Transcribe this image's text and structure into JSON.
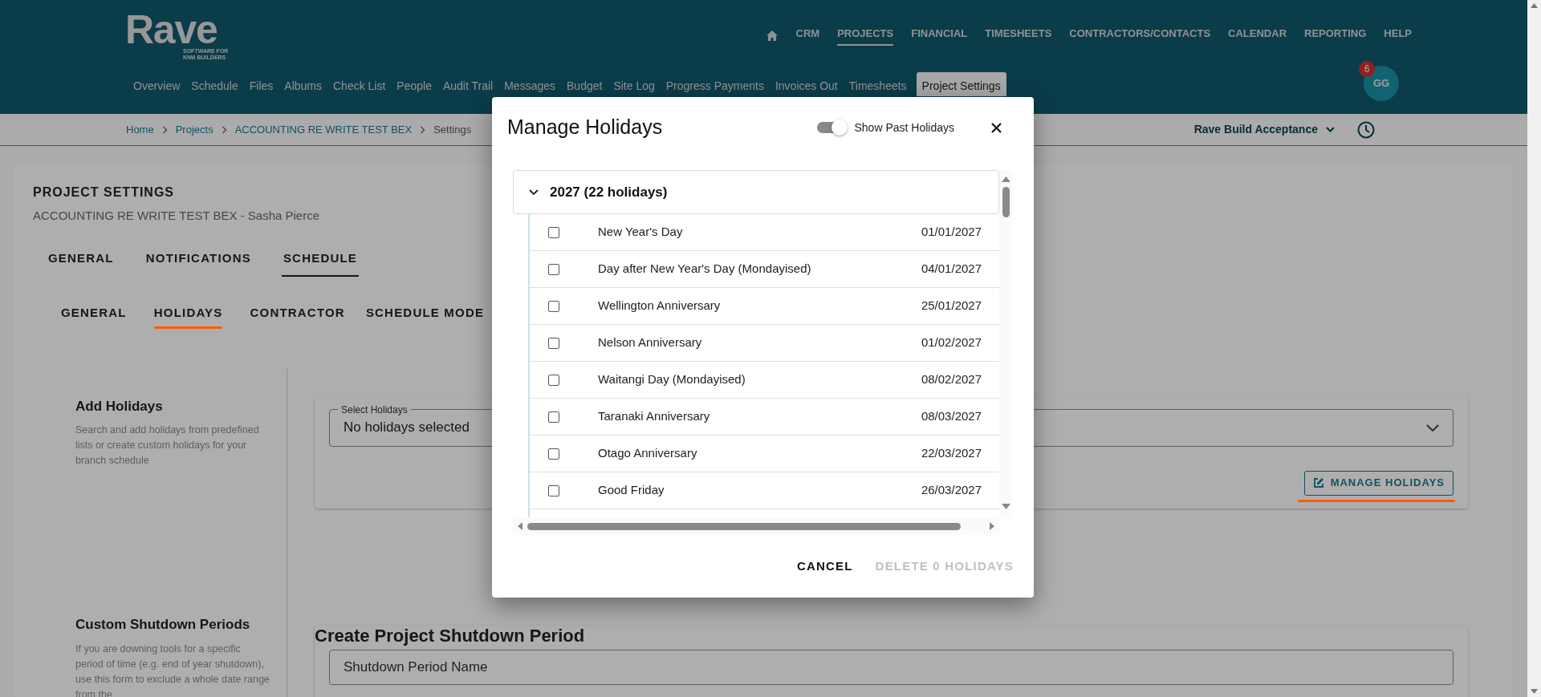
{
  "header": {
    "logo": {
      "name": "Rave",
      "tagline_lines": [
        "SOFTWARE FOR",
        "KIWI BUILDERS"
      ]
    },
    "main_nav": [
      {
        "label": "CRM",
        "selected": false
      },
      {
        "label": "PROJECTS",
        "selected": true
      },
      {
        "label": "FINANCIAL",
        "selected": false
      },
      {
        "label": "TIMESHEETS",
        "selected": false
      },
      {
        "label": "CONTRACTORS/CONTACTS",
        "selected": false
      },
      {
        "label": "CALENDAR",
        "selected": false
      },
      {
        "label": "REPORTING",
        "selected": false
      },
      {
        "label": "HELP",
        "selected": false
      }
    ],
    "sub_nav": [
      {
        "label": "Overview",
        "selected": false
      },
      {
        "label": "Schedule",
        "selected": false
      },
      {
        "label": "Files",
        "selected": false
      },
      {
        "label": "Albums",
        "selected": false
      },
      {
        "label": "Check List",
        "selected": false
      },
      {
        "label": "People",
        "selected": false
      },
      {
        "label": "Audit Trail",
        "selected": false
      },
      {
        "label": "Messages",
        "selected": false
      },
      {
        "label": "Budget",
        "selected": false
      },
      {
        "label": "Site Log",
        "selected": false
      },
      {
        "label": "Progress Payments",
        "selected": false
      },
      {
        "label": "Invoices Out",
        "selected": false
      },
      {
        "label": "Timesheets",
        "selected": false
      },
      {
        "label": "Project Settings",
        "selected": true
      }
    ],
    "avatar": {
      "initials": "GG",
      "badge": "6"
    }
  },
  "breadcrumb": [
    "Home",
    "Projects",
    "ACCOUNTING RE WRITE TEST BEX",
    "Settings"
  ],
  "workspace": "Rave Build Acceptance",
  "page": {
    "title": "PROJECT SETTINGS",
    "subtitle": "ACCOUNTING RE WRITE TEST BEX - Sasha Pierce",
    "tabs": [
      {
        "label": "GENERAL",
        "selected": false
      },
      {
        "label": "NOTIFICATIONS",
        "selected": false
      },
      {
        "label": "SCHEDULE",
        "selected": true
      }
    ],
    "sub_tabs": [
      {
        "label": "GENERAL",
        "selected": false
      },
      {
        "label": "HOLIDAYS",
        "selected": true
      },
      {
        "label": "CONTRACTOR",
        "selected": false
      },
      {
        "label": "SCHEDULE MODE",
        "selected": false
      }
    ],
    "add_holidays": {
      "title": "Add Holidays",
      "description": "Search and add holidays from predefined lists or create custom holidays for your branch schedule",
      "select_label": "Select Holidays",
      "select_value": "No holidays selected",
      "button": "MANAGE HOLIDAYS"
    },
    "shutdown": {
      "title": "Custom Shutdown Periods",
      "description": "If you are downing tools for a specific period of time (e.g. end of year shutdown), use this form to exclude a whole date range from the",
      "form_title": "Create Project Shutdown Period",
      "name_placeholder": "Shutdown Period Name"
    }
  },
  "modal": {
    "title": "Manage Holidays",
    "show_past": {
      "label": "Show Past Holidays",
      "on": true
    },
    "group": {
      "label": "2027 (22 holidays)",
      "expanded": true,
      "items": [
        {
          "name": "New Year's Day",
          "date": "01/01/2027",
          "checked": false
        },
        {
          "name": "Day after New Year's Day (Mondayised)",
          "date": "04/01/2027",
          "checked": false
        },
        {
          "name": "Wellington Anniversary",
          "date": "25/01/2027",
          "checked": false
        },
        {
          "name": "Nelson Anniversary",
          "date": "01/02/2027",
          "checked": false
        },
        {
          "name": "Waitangi Day (Mondayised)",
          "date": "08/02/2027",
          "checked": false
        },
        {
          "name": "Taranaki Anniversary",
          "date": "08/03/2027",
          "checked": false
        },
        {
          "name": "Otago Anniversary",
          "date": "22/03/2027",
          "checked": false
        },
        {
          "name": "Good Friday",
          "date": "26/03/2027",
          "checked": false
        }
      ]
    },
    "cancel": "CANCEL",
    "delete": {
      "label": "DELETE 0 HOLIDAYS",
      "disabled": true
    }
  }
}
